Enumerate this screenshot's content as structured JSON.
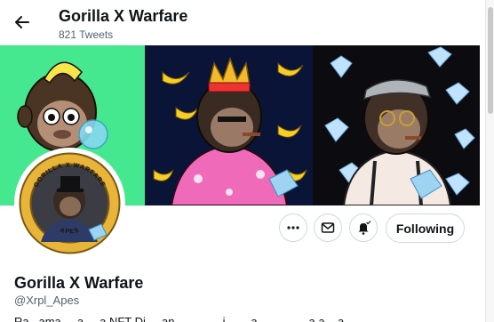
{
  "header": {
    "back_icon": "arrow-left-icon",
    "name": "Gorilla X Warfare",
    "tweet_count": "821 Tweets"
  },
  "banner": {
    "panels": [
      {
        "description_icon": "ape-bubblegum-art",
        "color": "#45e88e"
      },
      {
        "description_icon": "ape-king-bananas-art",
        "color": "#0a1436"
      },
      {
        "description_icon": "ape-diamonds-art",
        "color": "#0b0b10"
      }
    ]
  },
  "avatar": {
    "ring_text_top": "GORILLA X WARFARE",
    "ring_text_bottom": "APES",
    "ring_color": "#e8b43a"
  },
  "actions": {
    "more_icon": "more-dots-icon",
    "message_icon": "mail-icon",
    "notify_icon": "bell-check-icon",
    "follow_label": "Following"
  },
  "profile": {
    "name": "Gorilla X Warfare",
    "handle": "@Xrpl_Apes",
    "bio": "Ra_ ama_ _a_ _a NFT Di_ _an_ _ _ _ _ i_ _ _a _ _ _ _ _ a a _ a_ _ _ _ ___"
  }
}
